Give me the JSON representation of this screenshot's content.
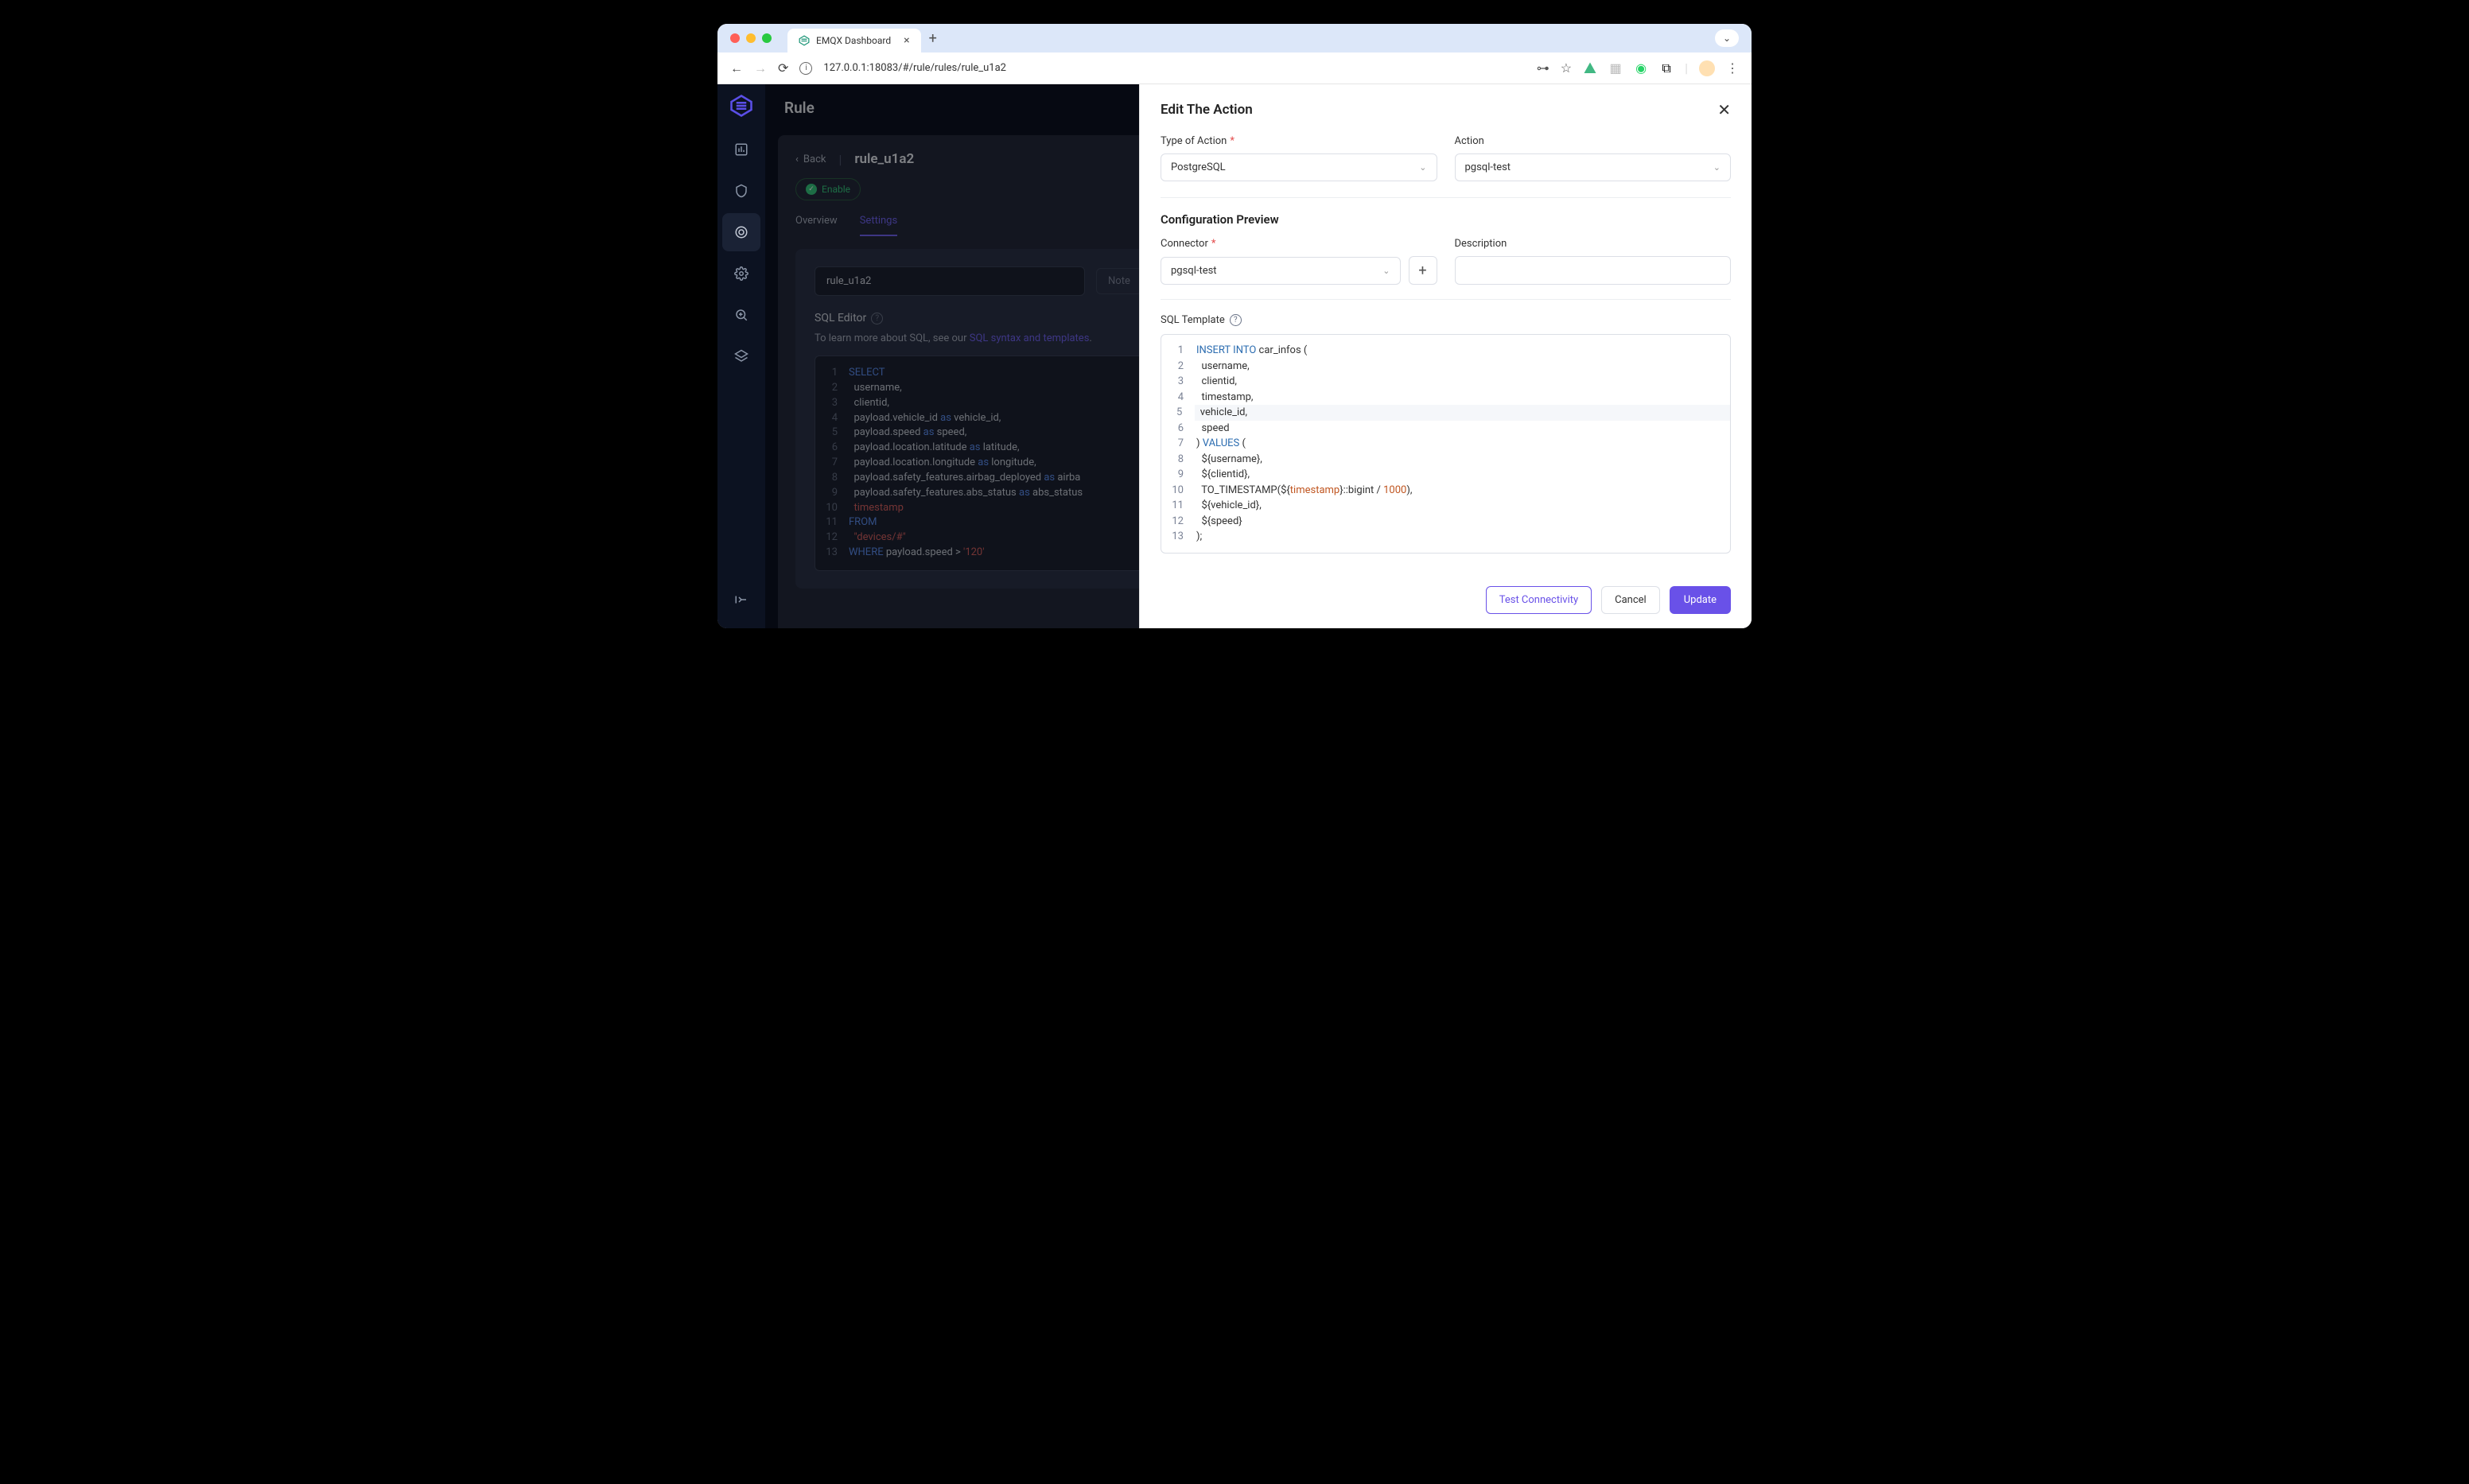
{
  "browser": {
    "tab_title": "EMQX Dashboard",
    "url": "127.0.0.1:18083/#/rule/rules/rule_u1a2"
  },
  "page": {
    "header": "Rule",
    "back": "Back",
    "rule_id": "rule_u1a2",
    "enable": "Enable",
    "tab_overview": "Overview",
    "tab_settings": "Settings",
    "rule_input": "rule_u1a2",
    "note_btn": "Note",
    "sql_title": "SQL Editor",
    "help_prefix": "To learn more about SQL, see our ",
    "help_link": "SQL syntax and templates",
    "help_suffix": "."
  },
  "sql_lines": [
    {
      "n": 1,
      "html": "<span class='kw'>SELECT</span>"
    },
    {
      "n": 2,
      "html": "  username,"
    },
    {
      "n": 3,
      "html": "  clientid,"
    },
    {
      "n": 4,
      "html": "  payload.vehicle_id <span class='as'>as</span> vehicle_id,"
    },
    {
      "n": 5,
      "html": "  payload.speed <span class='as'>as</span> speed,"
    },
    {
      "n": 6,
      "html": "  payload.location.latitude <span class='as'>as</span> latitude,"
    },
    {
      "n": 7,
      "html": "  payload.location.longitude <span class='as'>as</span> longitude,"
    },
    {
      "n": 8,
      "html": "  payload.safety_features.airbag_deployed <span class='as'>as</span> airba"
    },
    {
      "n": 9,
      "html": "  payload.safety_features.abs_status <span class='as'>as</span> abs_status"
    },
    {
      "n": 10,
      "html": "  <span class='str'>timestamp</span>"
    },
    {
      "n": 11,
      "html": "<span class='kw'>FROM</span>"
    },
    {
      "n": 12,
      "html": "  <span class='str'>\"devices/#\"</span>"
    },
    {
      "n": 13,
      "html": "<span class='kw'>WHERE</span> payload.speed > <span class='num'>'120'</span>"
    }
  ],
  "drawer": {
    "title": "Edit The Action",
    "type_label": "Type of Action",
    "type_value": "PostgreSQL",
    "action_label": "Action",
    "action_value": "pgsql-test",
    "preview_title": "Configuration Preview",
    "connector_label": "Connector",
    "connector_value": "pgsql-test",
    "desc_label": "Description",
    "desc_value": "",
    "tpl_label": "SQL Template",
    "test_btn": "Test Connectivity",
    "cancel_btn": "Cancel",
    "update_btn": "Update"
  },
  "tpl_lines": [
    {
      "n": 1,
      "html": "<span class='kw2'>INSERT</span> <span class='kw2'>INTO</span> car_infos ("
    },
    {
      "n": 2,
      "html": "  username,"
    },
    {
      "n": 3,
      "html": "  clientid,"
    },
    {
      "n": 4,
      "html": "  timestamp,"
    },
    {
      "n": 5,
      "html": "  vehicle_id,",
      "hl": true
    },
    {
      "n": 6,
      "html": "  speed"
    },
    {
      "n": 7,
      "html": ") <span class='kw2'>VALUES</span> ("
    },
    {
      "n": 8,
      "html": "  ${username},"
    },
    {
      "n": 9,
      "html": "  ${clientid},"
    },
    {
      "n": 10,
      "html": "  TO_TIMESTAMP(${<span class='str2'>timestamp</span>}::bigint / <span class='num2'>1000</span>),"
    },
    {
      "n": 11,
      "html": "  ${vehicle_id},"
    },
    {
      "n": 12,
      "html": "  ${speed}"
    },
    {
      "n": 13,
      "html": ");"
    }
  ]
}
